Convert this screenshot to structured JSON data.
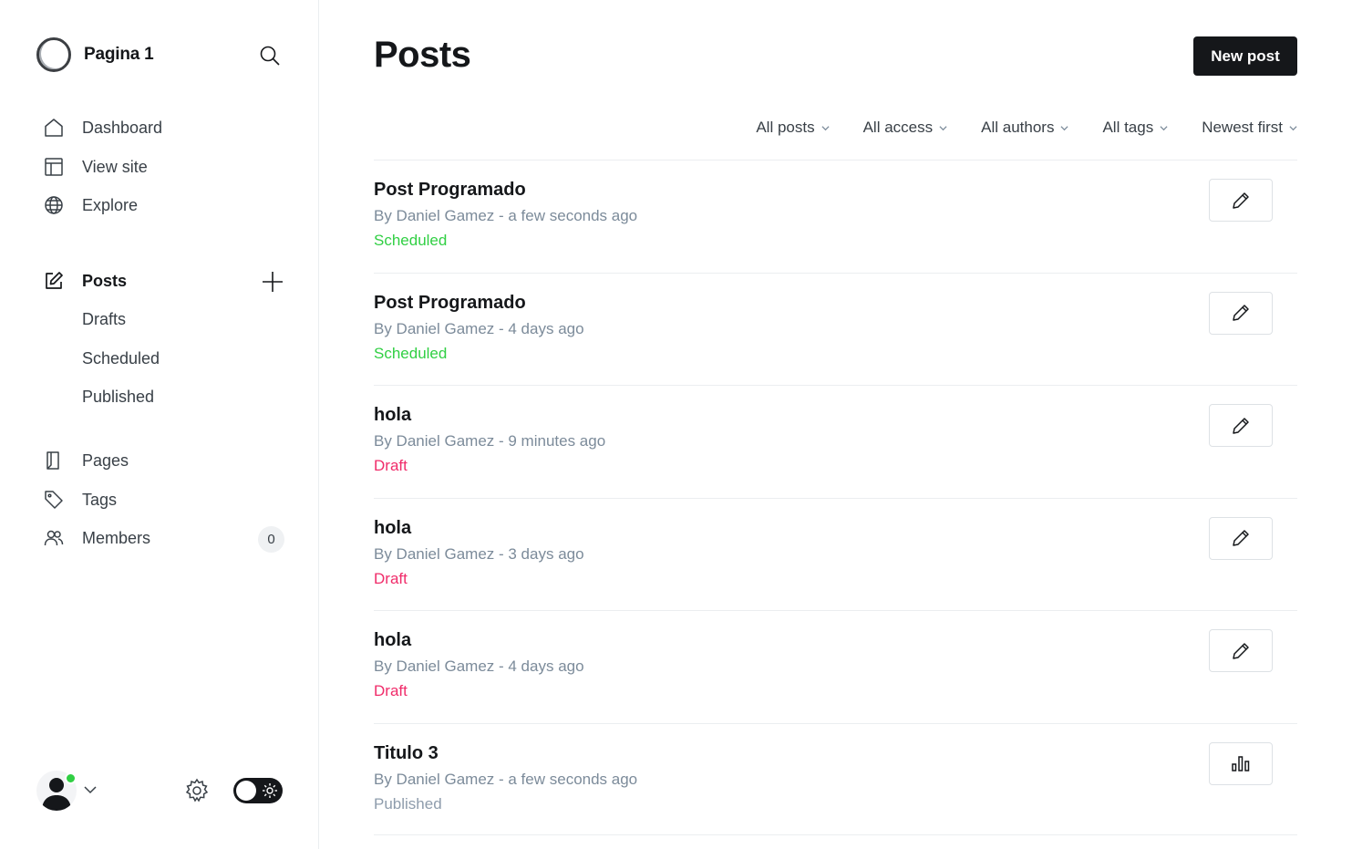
{
  "sidebar": {
    "site_name": "Pagina 1",
    "nav": [
      {
        "label": "Dashboard",
        "icon": "home-icon"
      },
      {
        "label": "View site",
        "icon": "layout-icon"
      },
      {
        "label": "Explore",
        "icon": "globe-icon"
      }
    ],
    "posts": {
      "label": "Posts",
      "sub": [
        "Drafts",
        "Scheduled",
        "Published"
      ]
    },
    "nav2": [
      {
        "label": "Pages",
        "icon": "page-icon"
      },
      {
        "label": "Tags",
        "icon": "tag-icon"
      },
      {
        "label": "Members",
        "icon": "members-icon",
        "count": "0"
      }
    ],
    "status_color": "#30cf43"
  },
  "main": {
    "title": "Posts",
    "new_post_label": "New post",
    "filters": [
      "All posts",
      "All access",
      "All authors",
      "All tags",
      "Newest first"
    ],
    "posts": [
      {
        "title": "Post Programado",
        "meta": "By Daniel Gamez - a few seconds ago",
        "status": "Scheduled",
        "action": "edit"
      },
      {
        "title": "Post Programado",
        "meta": "By Daniel Gamez - 4 days ago",
        "status": "Scheduled",
        "action": "edit"
      },
      {
        "title": "hola",
        "meta": "By Daniel Gamez - 9 minutes ago",
        "status": "Draft",
        "action": "edit"
      },
      {
        "title": "hola",
        "meta": "By Daniel Gamez - 3 days ago",
        "status": "Draft",
        "action": "edit"
      },
      {
        "title": "hola",
        "meta": "By Daniel Gamez - 4 days ago",
        "status": "Draft",
        "action": "edit"
      },
      {
        "title": "Titulo 3",
        "meta": "By Daniel Gamez - a few seconds ago",
        "status": "Published",
        "action": "analytics"
      }
    ]
  },
  "colors": {
    "accent_dark": "#15171a",
    "scheduled": "#30cf43",
    "draft": "#f02c6a",
    "published": "#8e9cac"
  }
}
